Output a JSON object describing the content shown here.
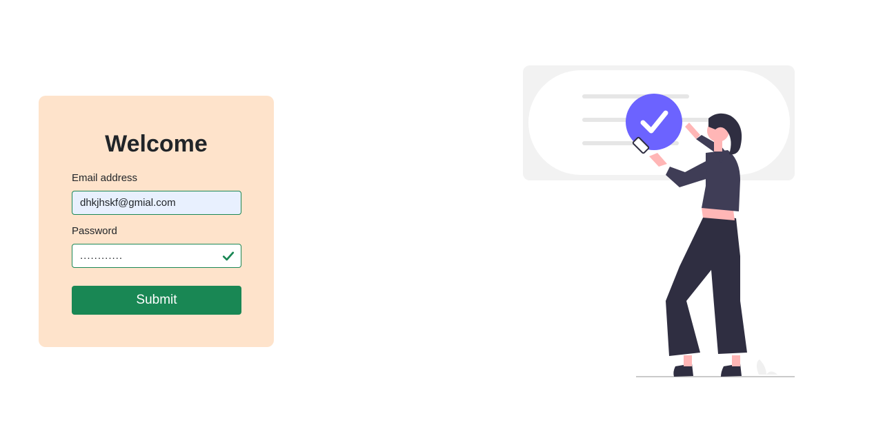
{
  "form": {
    "title": "Welcome",
    "email_label": "Email address",
    "email_value": "dhkjhskf@gmial.com",
    "password_label": "Password",
    "password_value": "............",
    "submit_label": "Submit"
  },
  "icons": {
    "password_valid": "checkmark-icon",
    "illustration_badge": "checkmark-badge-icon"
  },
  "colors": {
    "card_background": "#fee3cb",
    "success": "#198754",
    "autofill_background": "#e8f0fe",
    "illustration_accent": "#6c63ff",
    "illustration_dark": "#2f2e41",
    "illustration_skin": "#ffb6b6"
  }
}
